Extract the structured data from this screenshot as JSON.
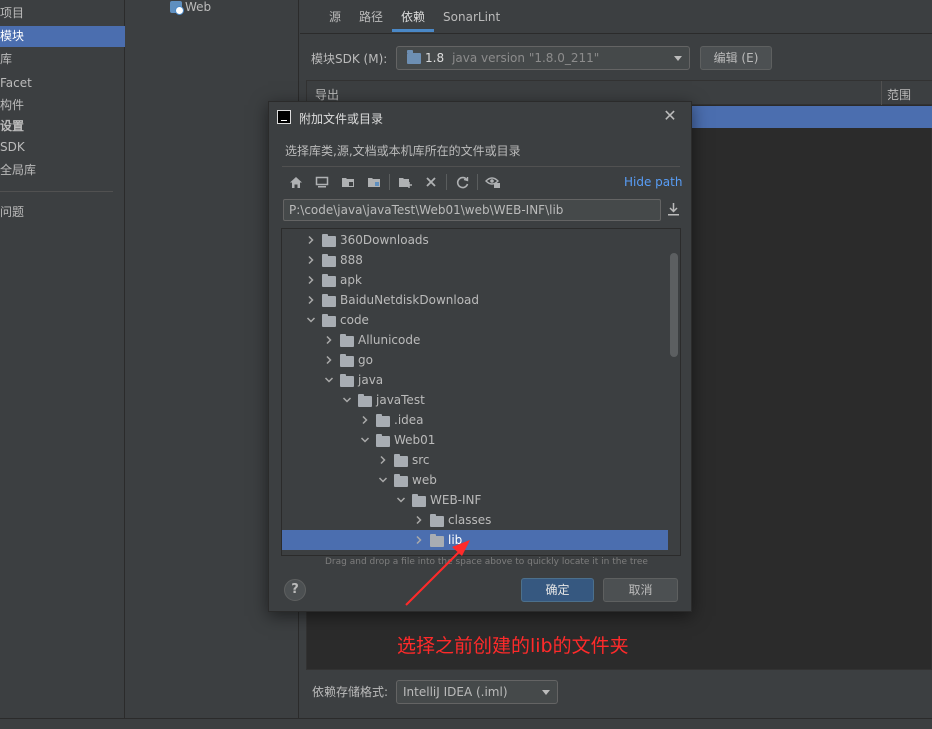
{
  "sidebar": {
    "items": [
      {
        "label": "项目"
      },
      {
        "label": "模块"
      },
      {
        "label": "库"
      },
      {
        "label": "Facet"
      },
      {
        "label": "构件"
      },
      {
        "label": "设置"
      },
      {
        "label": "SDK"
      },
      {
        "label": "全局库"
      },
      {
        "label": "问题"
      }
    ]
  },
  "module_tree": {
    "web_label": "Web"
  },
  "tabs": [
    {
      "label": "源"
    },
    {
      "label": "路径"
    },
    {
      "label": "依赖"
    },
    {
      "label": "SonarLint"
    }
  ],
  "sdk": {
    "label": "模块SDK (M):",
    "version": "1.8",
    "detail": "java version \"1.8.0_211\"",
    "edit_label": "编辑 (E)"
  },
  "dependencies": {
    "col_export": "导出",
    "col_scope": "范围"
  },
  "storage": {
    "label": "依赖存储格式:",
    "value": "IntelliJ IDEA (.iml)"
  },
  "dialog": {
    "title": "附加文件或目录",
    "description": "选择库类,源,文档或本机库所在的文件或目录",
    "hide_path": "Hide path",
    "path": "P:\\code\\java\\javaTest\\Web01\\web\\WEB-INF\\lib",
    "tree": [
      {
        "label": "360Downloads",
        "expanded": false
      },
      {
        "label": "888",
        "expanded": false
      },
      {
        "label": "apk",
        "expanded": false
      },
      {
        "label": "BaiduNetdiskDownload",
        "expanded": false
      },
      {
        "label": "code",
        "expanded": true
      },
      {
        "label": "Allunicode",
        "expanded": false
      },
      {
        "label": "go",
        "expanded": false
      },
      {
        "label": "java",
        "expanded": true
      },
      {
        "label": "javaTest",
        "expanded": true
      },
      {
        "label": ".idea",
        "expanded": false
      },
      {
        "label": "Web01",
        "expanded": true
      },
      {
        "label": "src",
        "expanded": false
      },
      {
        "label": "web",
        "expanded": true
      },
      {
        "label": "WEB-INF",
        "expanded": true
      },
      {
        "label": "classes",
        "expanded": false
      },
      {
        "label": "lib",
        "expanded": false,
        "selected": true
      }
    ],
    "drag_hint": "Drag and drop a file into the space above to quickly locate it in the tree",
    "help_label": "?",
    "ok_label": "确定",
    "cancel_label": "取消"
  },
  "annotation": {
    "text": "选择之前创建的lib的文件夹",
    "color": "#ff2a2a"
  },
  "colors": {
    "selection": "#4b6eaf",
    "link": "#589df6",
    "primary_button": "#365880"
  }
}
